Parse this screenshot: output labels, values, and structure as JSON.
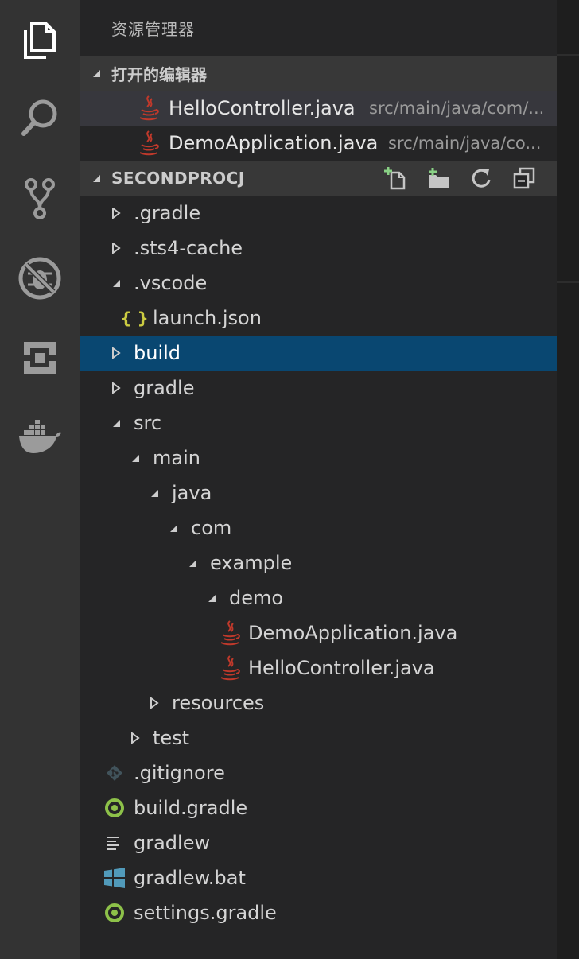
{
  "sidebar_title": "资源管理器",
  "open_editors": {
    "header": "打开的编辑器",
    "items": [
      {
        "name": "HelloController.java",
        "path": "src/main/java/com/...",
        "icon": "java-icon"
      },
      {
        "name": "DemoApplication.java",
        "path": "src/main/java/co...",
        "icon": "java-icon"
      }
    ]
  },
  "project": {
    "header": "SECONDPROCJ",
    "actions": [
      "new-file-icon",
      "new-folder-icon",
      "refresh-icon",
      "collapse-all-icon"
    ]
  },
  "tree": [
    {
      "label": ".gradle",
      "icon": "chevron-right-icon"
    },
    {
      "label": ".sts4-cache",
      "icon": "chevron-right-icon"
    },
    {
      "label": ".vscode",
      "icon": "chevron-down-icon"
    },
    {
      "label": "launch.json",
      "icon": "json-icon",
      "glyph": "{ }"
    },
    {
      "label": "build",
      "icon": "chevron-right-icon"
    },
    {
      "label": "gradle",
      "icon": "chevron-right-icon"
    },
    {
      "label": "src",
      "icon": "chevron-down-icon"
    },
    {
      "label": "main",
      "icon": "chevron-down-icon"
    },
    {
      "label": "java",
      "icon": "chevron-down-icon"
    },
    {
      "label": "com",
      "icon": "chevron-down-icon"
    },
    {
      "label": "example",
      "icon": "chevron-down-icon"
    },
    {
      "label": "demo",
      "icon": "chevron-down-icon"
    },
    {
      "label": "DemoApplication.java",
      "icon": "java-icon"
    },
    {
      "label": "HelloController.java",
      "icon": "java-icon"
    },
    {
      "label": "resources",
      "icon": "chevron-right-icon"
    },
    {
      "label": "test",
      "icon": "chevron-right-icon"
    },
    {
      "label": ".gitignore",
      "icon": "git-icon"
    },
    {
      "label": "build.gradle",
      "icon": "gradle-icon"
    },
    {
      "label": "gradlew",
      "icon": "text-file-icon"
    },
    {
      "label": "gradlew.bat",
      "icon": "windows-icon"
    },
    {
      "label": "settings.gradle",
      "icon": "gradle-icon"
    }
  ],
  "activity_bar": [
    "explorer-icon",
    "search-icon",
    "source-control-icon",
    "debug-icon",
    "extensions-icon",
    "docker-icon"
  ],
  "colors": {
    "selection": "#094771",
    "java_icon": "#c0392b",
    "json_icon": "#cbcb41",
    "gradle_icon": "#8dc149",
    "windows_icon": "#519aba",
    "add_badge": "#89d185"
  }
}
